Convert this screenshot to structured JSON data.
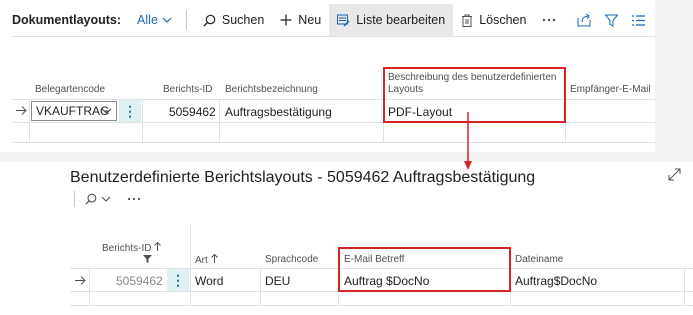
{
  "toolbar": {
    "title": "Dokumentlayouts:",
    "filter": "Alle",
    "search": "Suchen",
    "new": "Neu",
    "edit_list": "Liste bearbeiten",
    "delete": "Löschen"
  },
  "grid1": {
    "columns": {
      "belegartencode": "Belegartencode",
      "berichts_id": "Berichts-ID",
      "berichtsbezeichnung": "Berichtsbezeichnung",
      "beschreibung_line1": "Beschreibung des benutzerdefinierten",
      "beschreibung_line2": "Layouts",
      "empfaenger": "Empfänger-E-Mail"
    },
    "row": {
      "belegartencode": "VKAUFTRAG",
      "berichts_id": "5059462",
      "berichtsbezeichnung": "Auftragsbestätigung",
      "beschreibung": "PDF-Layout"
    }
  },
  "page2": {
    "title": "Benutzerdefinierte Berichtslayouts - 5059462 Auftragsbestätigung"
  },
  "grid2": {
    "columns": {
      "berichts_id": "Berichts-ID",
      "art": "Art",
      "sprachcode": "Sprachcode",
      "email_betreff": "E-Mail Betreff",
      "dateiname": "Dateiname"
    },
    "row": {
      "berichts_id": "5059462",
      "art": "Word",
      "sprachcode": "DEU",
      "email_betreff": "Auftrag $DocNo",
      "dateiname": "Auftrag$DocNo"
    }
  },
  "colors": {
    "accent": "#1566b7",
    "highlight": "#d52424",
    "dots_bg": "#dff1f3"
  },
  "icons": [
    "chevron-down-icon",
    "search-icon",
    "plus-icon",
    "edit-list-icon",
    "trash-icon",
    "ellipsis-icon",
    "share-icon",
    "filter-icon",
    "list-view-icon",
    "row-arrow-icon",
    "expand-icon",
    "sort-up-icon",
    "filter-funnel-icon",
    "row-actions-icon",
    "red-arrow"
  ]
}
